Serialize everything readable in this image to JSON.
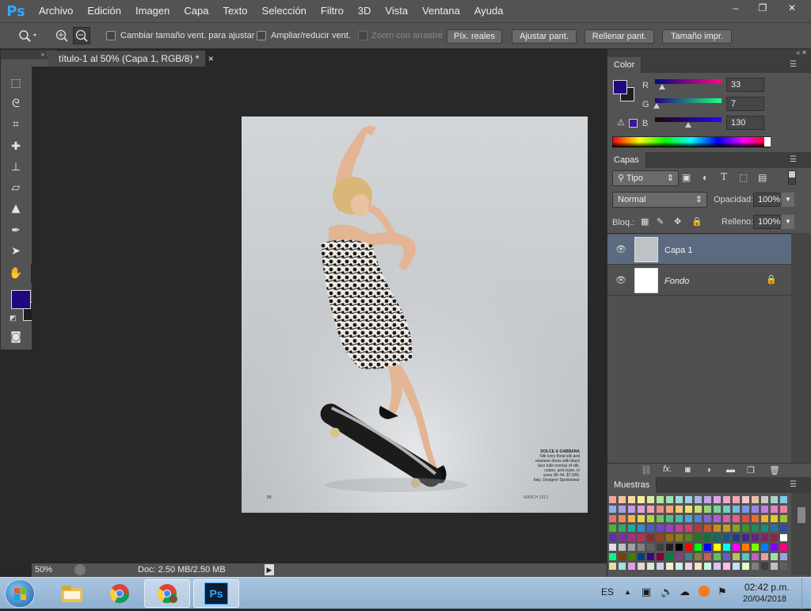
{
  "app": {
    "logo": "Ps",
    "menu": [
      "Archivo",
      "Edición",
      "Imagen",
      "Capa",
      "Texto",
      "Selección",
      "Filtro",
      "3D",
      "Vista",
      "Ventana",
      "Ayuda"
    ],
    "window_controls": [
      "–",
      "❐",
      "✕"
    ]
  },
  "options_bar": {
    "checkboxes": [
      {
        "label": "Cambiar tamaño vent. para ajustar",
        "checked": false,
        "enabled": true
      },
      {
        "label": "Ampliar/reducir vent.",
        "checked": false,
        "enabled": true
      },
      {
        "label": "Zoom con arrastre",
        "checked": false,
        "enabled": false
      }
    ],
    "buttons": [
      "Píx. reales",
      "Ajustar pant.",
      "Rellenar pant.",
      "Tamaño impr."
    ]
  },
  "document": {
    "tab_title": "título-1 al 50% (Capa 1, RGB/8) *",
    "close_glyph": "×"
  },
  "status": {
    "zoom": "50%",
    "doc_size": "Doc: 2.50 MB/2.50 MB"
  },
  "photo": {
    "caption_title": "DOLCE & GABBANA",
    "caption_lines": [
      "Silk ivory floral silk and",
      "elastane dress with black",
      "lace tulle overlay of silk,",
      "cotton, and nylon, in",
      "sizes 38–44. $7,945.",
      "Italy. Designer Sportswear"
    ],
    "page_number": "58",
    "issue": "MARCH 2013"
  },
  "color_panel": {
    "tab": "Color",
    "r_label": "R",
    "g_label": "G",
    "b_label": "B",
    "r": "33",
    "g": "7",
    "b": "130",
    "foreground": "#210782",
    "background": "#1e1e1e",
    "warning_glyph": "⚠"
  },
  "layers_panel": {
    "tab": "Capas",
    "filter_kind": "Tipo",
    "blend_mode": "Normal",
    "opacity_label": "Opacidad:",
    "opacity": "100%",
    "lock_label": "Bloq.:",
    "fill_label": "Relleno:",
    "fill": "100%",
    "layers": [
      {
        "name": "Capa 1",
        "selected": true,
        "locked": false
      },
      {
        "name": "Fondo",
        "selected": false,
        "locked": true
      }
    ],
    "footer_icons": [
      "link-icon",
      "fx-icon",
      "mask-icon",
      "adjustment-icon",
      "folder-icon",
      "new-layer-icon",
      "trash-icon"
    ]
  },
  "swatches_panel": {
    "tab": "Muestras",
    "colors": [
      "#f4a3a3",
      "#f7c1a0",
      "#f8d9a2",
      "#f4eda1",
      "#d8ec9f",
      "#b6e3a0",
      "#a3dfb8",
      "#a0dcd4",
      "#a3cfe6",
      "#a7b5e6",
      "#c1a8e6",
      "#dba7e3",
      "#eba6cc",
      "#f2a6b3",
      "#f4c7c7",
      "#e6c3a4",
      "#c9c9c9",
      "#a8d3cc",
      "#7fc8e8",
      "#8fb0e6",
      "#a79fe6",
      "#c39be6",
      "#e39fd8",
      "#ef9fbb",
      "#f28b8b",
      "#f5a877",
      "#f7c77a",
      "#f0e173",
      "#c8e271",
      "#98d673",
      "#7cd39e",
      "#6fd0c6",
      "#71bde3",
      "#7c96e3",
      "#9d84e3",
      "#c37fe0",
      "#e47fc7",
      "#ef7fa0",
      "#e86f6f",
      "#f08c54",
      "#f3b552",
      "#e9d748",
      "#b2d64c",
      "#72c653",
      "#4fc184",
      "#44bdb3",
      "#4aa6dc",
      "#5c7ddd",
      "#8665dc",
      "#b05ed8",
      "#d85eb6",
      "#e85e88",
      "#d94b4b",
      "#e86c2f",
      "#ecb02b",
      "#e0c92a",
      "#9ac62f",
      "#4bb537",
      "#2aae6c",
      "#23a99d",
      "#2b8fd0",
      "#3f60d0",
      "#6e46cf",
      "#9b3fca",
      "#c83f9f",
      "#d94070",
      "#b83737",
      "#c85724",
      "#c98d1f",
      "#bba520",
      "#7fa622",
      "#379529",
      "#1d8f55",
      "#198b80",
      "#1f74ad",
      "#2f4bad",
      "#5735ab",
      "#7d2fa8",
      "#a53084",
      "#b8315c",
      "#8f2a2a",
      "#9a431b",
      "#9b6c16",
      "#8f7e17",
      "#617f1a",
      "#2a721f",
      "#156d41",
      "#126a62",
      "#175986",
      "#233a86",
      "#432984",
      "#612482",
      "#7f2565",
      "#8f2547",
      "#ffffff",
      "#e0e0e0",
      "#c0c0c0",
      "#a0a0a0",
      "#808080",
      "#606060",
      "#404040",
      "#202020",
      "#000000",
      "#ff0000",
      "#00ff00",
      "#0000ff",
      "#ffff00",
      "#00ffff",
      "#ff00ff",
      "#ff8000",
      "#80ff00",
      "#0080ff",
      "#8000ff",
      "#ff0080",
      "#00ff80",
      "#804000",
      "#408000",
      "#004080",
      "#400080",
      "#800040",
      "#008040",
      "#804080",
      "#408080",
      "#808040",
      "#c06060",
      "#60c060",
      "#6060c0",
      "#c0c060",
      "#60c0c0",
      "#c060c0",
      "#e0a0a0",
      "#a0e0a0",
      "#a0a0e0",
      "#e0e0a0",
      "#a0e0e0",
      "#e0a0e0",
      "#f0d0d0",
      "#d0f0d0",
      "#d0d0f0",
      "#f0f0d0",
      "#d0f0f0",
      "#f0d0f0",
      "#ffe0c0",
      "#c0ffe0",
      "#e0c0ff",
      "#ffc0e0",
      "#c0e0ff",
      "#e0ffc0",
      "#7f7f7f",
      "#3f3f3f",
      "#bfbfbf",
      "#5f5f5f",
      "#9f9f9f",
      "#dfdfdf",
      "#1f1f1f",
      "#efefef",
      "#2f2f2f",
      "#cfcfcf",
      "#6f6f6f",
      "#afafaf"
    ]
  },
  "taskbar": {
    "language": "ES",
    "time": "02:42 p.m.",
    "date": "20/04/2018",
    "apps": [
      "explorer-icon",
      "chrome-icon",
      "chrome-user-icon",
      "photoshop-icon"
    ]
  }
}
